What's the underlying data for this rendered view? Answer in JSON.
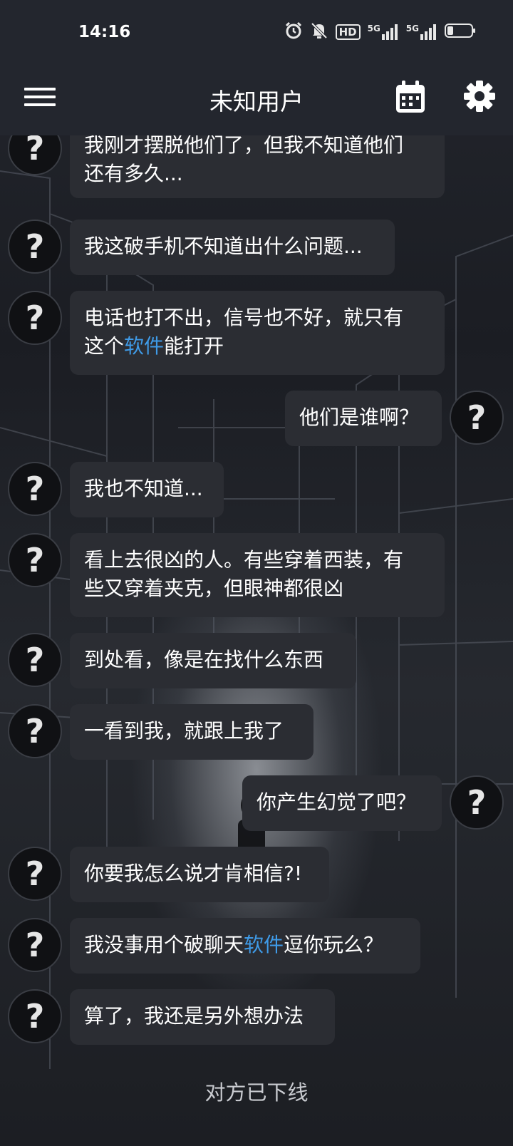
{
  "status_bar": {
    "time": "14:16",
    "icons": [
      "alarm-icon",
      "mute-icon",
      "hd-icon",
      "signal-5g-icon",
      "signal-5g-icon",
      "battery-icon"
    ],
    "hd_label": "HD",
    "net1": "5G",
    "net2": "5G"
  },
  "app_bar": {
    "title": "未知用户",
    "left_icon": "menu-icon",
    "right_icons": [
      "calendar-icon",
      "gear-icon"
    ]
  },
  "avatar_glyph": "?",
  "messages": [
    {
      "side": "left",
      "lines": [
        "我刚才摆脱他们了，但我不知道他们",
        "还有多久..."
      ]
    },
    {
      "side": "left",
      "lines": [
        "我这破手机不知道出什么问题..."
      ]
    },
    {
      "side": "left",
      "line1": "电话也打不出，信号也不好，就只有",
      "line2_pre": "这个",
      "line2_link": "软件",
      "line2_post": "能打开"
    },
    {
      "side": "right",
      "lines": [
        "他们是谁啊？"
      ]
    },
    {
      "side": "left",
      "lines": [
        "我也不知道..."
      ]
    },
    {
      "side": "left",
      "lines": [
        "看上去很凶的人。有些穿着西装，有",
        "些又穿着夹克，但眼神都很凶"
      ]
    },
    {
      "side": "left",
      "lines": [
        "到处看，像是在找什么东西"
      ]
    },
    {
      "side": "left",
      "lines": [
        "一看到我，就跟上我了"
      ]
    },
    {
      "side": "right",
      "lines": [
        "你产生幻觉了吧？"
      ]
    },
    {
      "side": "left",
      "lines": [
        "你要我怎么说才肯相信?!"
      ]
    },
    {
      "side": "left",
      "pre": "我没事用个破聊天",
      "link": "软件",
      "post": "逗你玩么？"
    },
    {
      "side": "left",
      "lines": [
        "算了，我还是另外想办法"
      ]
    }
  ],
  "offline_notice": "对方已下线",
  "colors": {
    "bar": "#23262e",
    "bubble": "#2b2d33",
    "link": "#3f9be8"
  }
}
